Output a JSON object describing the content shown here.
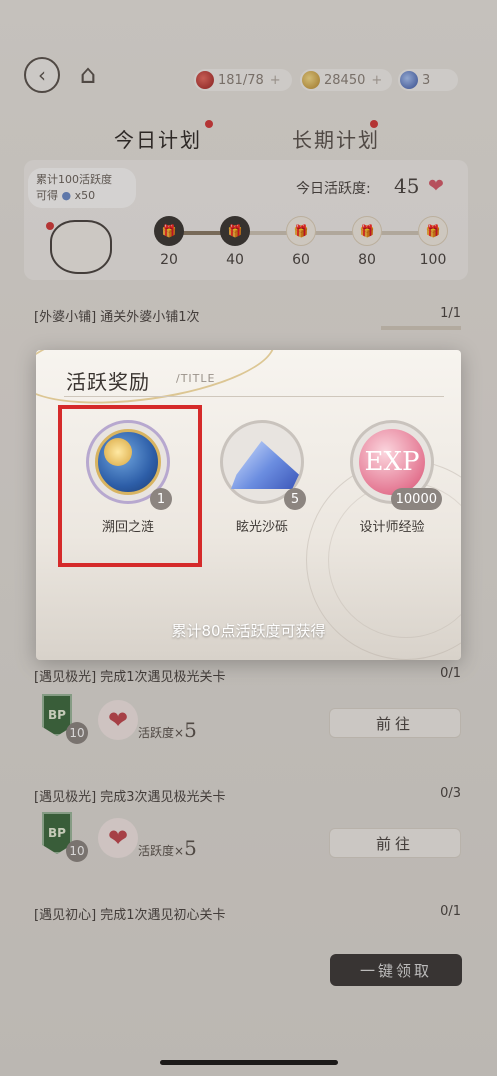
{
  "header": {
    "resources": [
      {
        "icon": "red-fruit-icon",
        "value": "181/78"
      },
      {
        "icon": "gold-coin-icon",
        "value": "28450"
      },
      {
        "icon": "blue-gem-icon",
        "value": "3"
      }
    ]
  },
  "tabs": {
    "today": "今日计划",
    "long_term": "长期计划"
  },
  "plan": {
    "accumulate_badge_line1": "累计100活跃度",
    "accumulate_badge_line2": "可得",
    "accumulate_badge_qty": "x50",
    "activity_label": "今日活跃度:",
    "activity_value": "45",
    "milestones": [
      "20",
      "40",
      "60",
      "80",
      "100"
    ]
  },
  "tasks": [
    {
      "title": "[外婆小铺] 通关外婆小铺1次",
      "count": "1/1"
    },
    {
      "title": "[遇见极光] 完成1次遇见极光关卡",
      "count": "0/1",
      "bp": "BP",
      "bp_count": "10",
      "reward_label": "活跃度×",
      "reward_value": "5",
      "button": "前往"
    },
    {
      "title": "[遇见极光] 完成3次遇见极光关卡",
      "count": "0/3",
      "bp": "BP",
      "bp_count": "10",
      "reward_label": "活跃度×",
      "reward_value": "5",
      "button": "前往"
    },
    {
      "title": "[遇见初心] 完成1次遇见初心关卡",
      "count": "0/1"
    }
  ],
  "claim_all": "一键领取",
  "popup": {
    "title": "活跃奖励",
    "subtitle": "/TITLE",
    "items": [
      {
        "name": "溯回之涟",
        "qty": "1"
      },
      {
        "name": "眩光沙砾",
        "qty": "5"
      },
      {
        "name": "设计师经验",
        "qty": "10000",
        "icon_text": "EXP"
      }
    ],
    "footer": "累计80点活跃度可获得"
  },
  "colors": {
    "highlight": "#d52a2a",
    "heart": "#d65b6a",
    "bp_green": "#3d6b3f"
  }
}
